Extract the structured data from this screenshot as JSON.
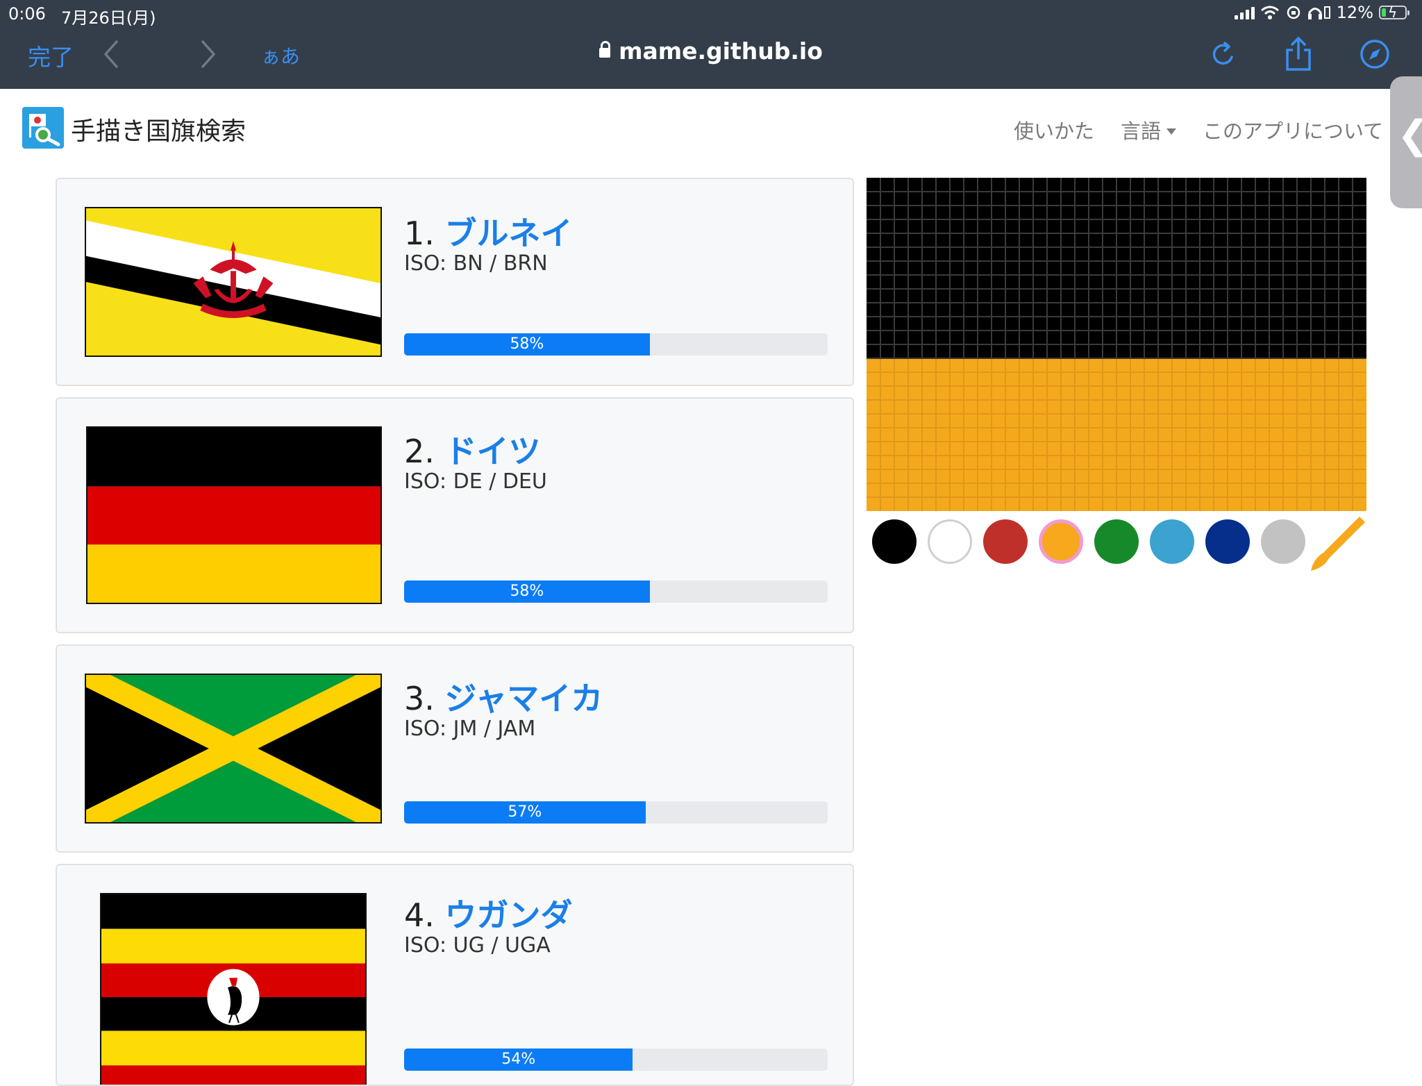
{
  "status": {
    "time": "0:06",
    "date": "7月26日(月)",
    "battery": "12%"
  },
  "browser": {
    "done": "完了",
    "text_size": "ぁあ",
    "url": "mame.github.io"
  },
  "site": {
    "title": "手描き国旗検索",
    "nav": {
      "usage": "使いかた",
      "language": "言語",
      "about": "このアプリについて"
    },
    "side_handle": "❮"
  },
  "results": [
    {
      "rank": "1.",
      "name": "ブルネイ",
      "iso": "ISO: BN / BRN",
      "score": 58,
      "score_label": "58%"
    },
    {
      "rank": "2.",
      "name": "ドイツ",
      "iso": "ISO: DE / DEU",
      "score": 58,
      "score_label": "58%"
    },
    {
      "rank": "3.",
      "name": "ジャマイカ",
      "iso": "ISO: JM / JAM",
      "score": 57,
      "score_label": "57%"
    },
    {
      "rank": "4.",
      "name": "ウガンダ",
      "iso": "ISO: UG / UGA",
      "score": 54,
      "score_label": "54%"
    }
  ],
  "canvas": {
    "cols": 36,
    "rows": 24,
    "top_rows_color": "#000000",
    "top_rows": 13,
    "bottom_color": "#f4a81c",
    "grid_color_dark": "#3a3a3a",
    "grid_color_light": "#e09818"
  },
  "palette": {
    "colors": [
      "#000000",
      "#ffffff",
      "#c0302a",
      "#f7a81c",
      "#168a2a",
      "#3ca2d0",
      "#062f8c",
      "#c2c2c2"
    ],
    "selected_index": 3,
    "pen_color": "#f7a81c"
  },
  "flag_colors": {
    "brunei_yellow": "#f7e017",
    "brunei_crest": "#cf1126",
    "germany_black": "#000000",
    "germany_red": "#dd0000",
    "germany_gold": "#ffce00",
    "jamaica_green": "#009b3a",
    "jamaica_gold": "#fed100",
    "uganda_yellow": "#fcdc04",
    "uganda_red": "#d90000"
  }
}
